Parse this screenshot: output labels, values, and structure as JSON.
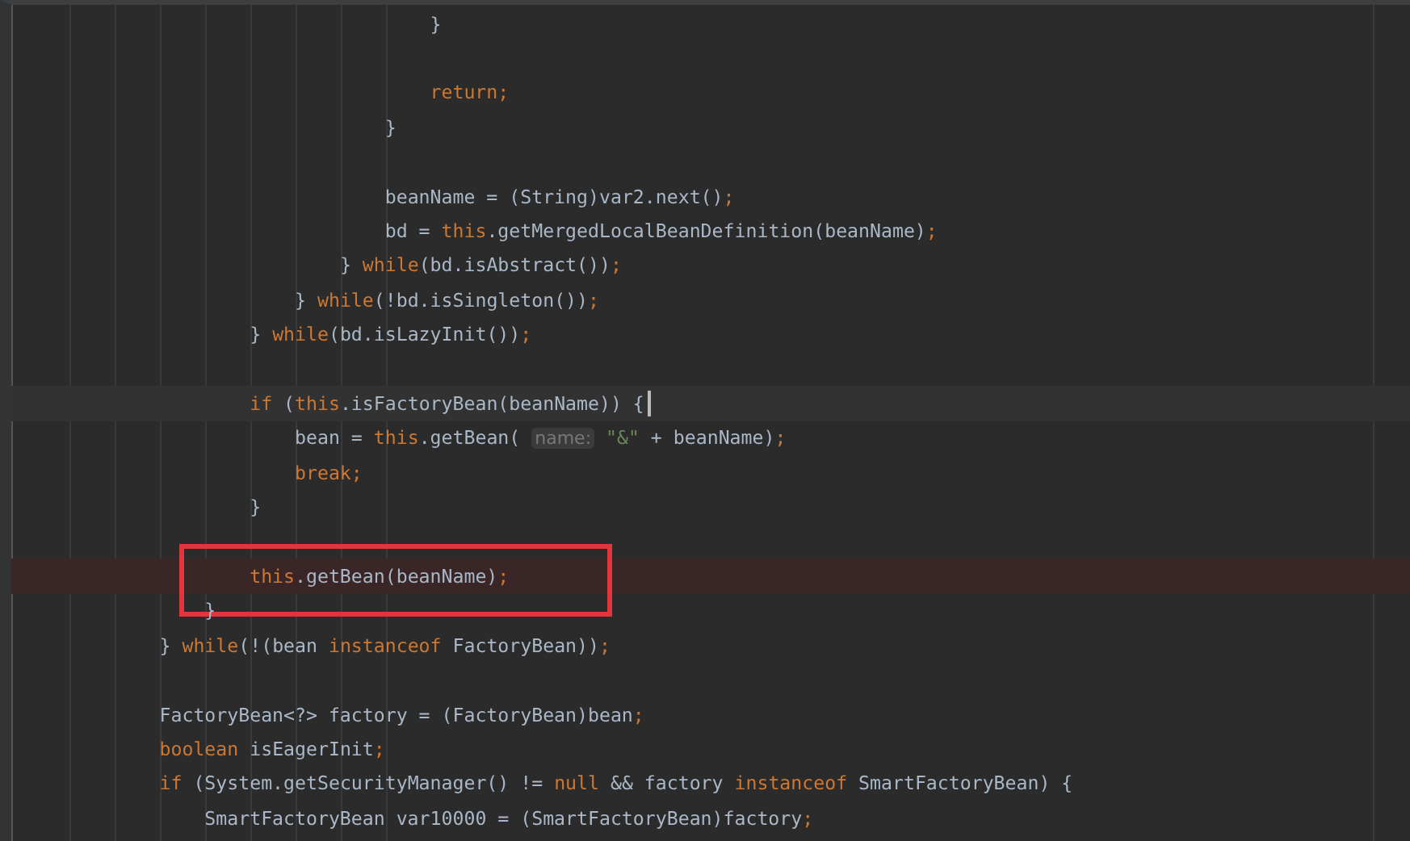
{
  "lines": [
    {
      "kind": "block",
      "children": [
        {
          "kind": "block",
          "children": [
            {
              "kind": "block",
              "children": [
                {
                  "kind": "block",
                  "children": [
                    {
                      "kind": "block",
                      "children": [
                        {
                          "kind": "block",
                          "children": [
                            {
                              "kind": "code",
                              "current": false,
                              "breakpoint": false,
                              "framed": false,
                              "tokens": [
                                {
                                  "kind": "plain",
                                  "text": "}"
                                }
                              ]
                            },
                            {
                              "kind": "blank"
                            },
                            {
                              "kind": "code",
                              "current": false,
                              "breakpoint": false,
                              "framed": false,
                              "tokens": [
                                {
                                  "kind": "keyword",
                                  "text": "return;"
                                }
                              ]
                            }
                          ]
                        },
                        {
                          "kind": "code",
                          "current": false,
                          "breakpoint": false,
                          "framed": false,
                          "tokens": [
                            {
                              "kind": "plain",
                              "text": "}"
                            }
                          ]
                        },
                        {
                          "kind": "blank"
                        },
                        {
                          "kind": "code",
                          "current": false,
                          "breakpoint": false,
                          "framed": false,
                          "tokens": [
                            {
                              "kind": "plain",
                              "text": "beanName = (String)var2.next()"
                            },
                            {
                              "kind": "keyword",
                              "text": ";"
                            }
                          ]
                        },
                        {
                          "kind": "code",
                          "current": false,
                          "breakpoint": false,
                          "framed": false,
                          "tokens": [
                            {
                              "kind": "plain",
                              "text": "bd = "
                            },
                            {
                              "kind": "keyword",
                              "text": "this"
                            },
                            {
                              "kind": "plain",
                              "text": ".getMergedLocalBeanDefinition(beanName)"
                            },
                            {
                              "kind": "keyword",
                              "text": ";"
                            }
                          ]
                        }
                      ]
                    },
                    {
                      "kind": "code",
                      "current": false,
                      "breakpoint": false,
                      "framed": false,
                      "tokens": [
                        {
                          "kind": "plain",
                          "text": "} "
                        },
                        {
                          "kind": "keyword",
                          "text": "while"
                        },
                        {
                          "kind": "plain",
                          "text": "(bd.isAbstract())"
                        },
                        {
                          "kind": "keyword",
                          "text": ";"
                        }
                      ]
                    }
                  ]
                },
                {
                  "kind": "code",
                  "current": false,
                  "breakpoint": false,
                  "framed": false,
                  "tokens": [
                    {
                      "kind": "plain",
                      "text": "} "
                    },
                    {
                      "kind": "keyword",
                      "text": "while"
                    },
                    {
                      "kind": "plain",
                      "text": "(!bd.isSingleton())"
                    },
                    {
                      "kind": "keyword",
                      "text": ";"
                    }
                  ]
                }
              ]
            },
            {
              "kind": "code",
              "current": false,
              "breakpoint": false,
              "framed": false,
              "tokens": [
                {
                  "kind": "plain",
                  "text": "} "
                },
                {
                  "kind": "keyword",
                  "text": "while"
                },
                {
                  "kind": "plain",
                  "text": "(bd.isLazyInit())"
                },
                {
                  "kind": "keyword",
                  "text": ";"
                }
              ]
            },
            {
              "kind": "blank"
            },
            {
              "kind": "code",
              "current": true,
              "breakpoint": false,
              "framed": false,
              "tokens": [
                {
                  "kind": "keyword",
                  "text": "if"
                },
                {
                  "kind": "plain",
                  "text": " ("
                },
                {
                  "kind": "keyword",
                  "text": "this"
                },
                {
                  "kind": "plain",
                  "text": ".isFactoryBean(beanName)) {"
                }
              ],
              "children": [
                {
                  "kind": "code",
                  "current": false,
                  "breakpoint": false,
                  "framed": false,
                  "tokens": [
                    {
                      "kind": "plain",
                      "text": "bean = "
                    },
                    {
                      "kind": "keyword",
                      "text": "this"
                    },
                    {
                      "kind": "plain",
                      "text": ".getBean( "
                    },
                    {
                      "kind": "hint",
                      "text": "name:"
                    },
                    {
                      "kind": "string",
                      "text": " \"&\""
                    },
                    {
                      "kind": "plain",
                      "text": " + beanName)"
                    },
                    {
                      "kind": "keyword",
                      "text": ";"
                    }
                  ]
                },
                {
                  "kind": "code",
                  "current": false,
                  "breakpoint": false,
                  "framed": false,
                  "tokens": [
                    {
                      "kind": "keyword",
                      "text": "break;"
                    }
                  ]
                }
              ]
            },
            {
              "kind": "code",
              "current": false,
              "breakpoint": false,
              "framed": false,
              "tokens": [
                {
                  "kind": "plain",
                  "text": "}"
                }
              ]
            },
            {
              "kind": "blank"
            },
            {
              "kind": "code",
              "current": false,
              "breakpoint": true,
              "framed": true,
              "tokens": [
                {
                  "kind": "keyword",
                  "text": "this"
                },
                {
                  "kind": "plain",
                  "text": ".getBean(beanName)"
                },
                {
                  "kind": "keyword",
                  "text": ";"
                }
              ]
            }
          ]
        },
        {
          "kind": "code",
          "current": false,
          "breakpoint": false,
          "framed": false,
          "tokens": [
            {
              "kind": "plain",
              "text": "}"
            }
          ]
        }
      ]
    },
    {
      "kind": "code",
      "current": false,
      "breakpoint": false,
      "framed": false,
      "tokens": [
        {
          "kind": "plain",
          "text": "} "
        },
        {
          "kind": "keyword",
          "text": "while"
        },
        {
          "kind": "plain",
          "text": "(!(bean "
        },
        {
          "kind": "keyword",
          "text": "instanceof"
        },
        {
          "kind": "plain",
          "text": " FactoryBean))"
        },
        {
          "kind": "keyword",
          "text": ";"
        }
      ]
    },
    {
      "kind": "blank"
    },
    {
      "kind": "code",
      "current": false,
      "breakpoint": false,
      "framed": false,
      "tokens": [
        {
          "kind": "plain",
          "text": "FactoryBean<?> factory = (FactoryBean)bean"
        },
        {
          "kind": "keyword",
          "text": ";"
        }
      ]
    },
    {
      "kind": "code",
      "current": false,
      "breakpoint": false,
      "framed": false,
      "tokens": [
        {
          "kind": "keyword",
          "text": "boolean"
        },
        {
          "kind": "plain",
          "text": " isEagerInit"
        },
        {
          "kind": "keyword",
          "text": ";"
        }
      ]
    },
    {
      "kind": "code",
      "current": false,
      "breakpoint": false,
      "framed": false,
      "tokens": [
        {
          "kind": "keyword",
          "text": "if"
        },
        {
          "kind": "plain",
          "text": " (System.getSecurityManager() != "
        },
        {
          "kind": "keyword",
          "text": "null"
        },
        {
          "kind": "plain",
          "text": " && factory "
        },
        {
          "kind": "keyword",
          "text": "instanceof"
        },
        {
          "kind": "plain",
          "text": " SmartFactoryBean) {"
        }
      ],
      "children": [
        {
          "kind": "code",
          "current": false,
          "breakpoint": false,
          "framed": false,
          "tokens": [
            {
              "kind": "plain",
              "text": "SmartFactoryBean var10000 = (SmartFactoryBean)factory"
            },
            {
              "kind": "keyword",
              "text": ";"
            }
          ]
        }
      ]
    }
  ]
}
